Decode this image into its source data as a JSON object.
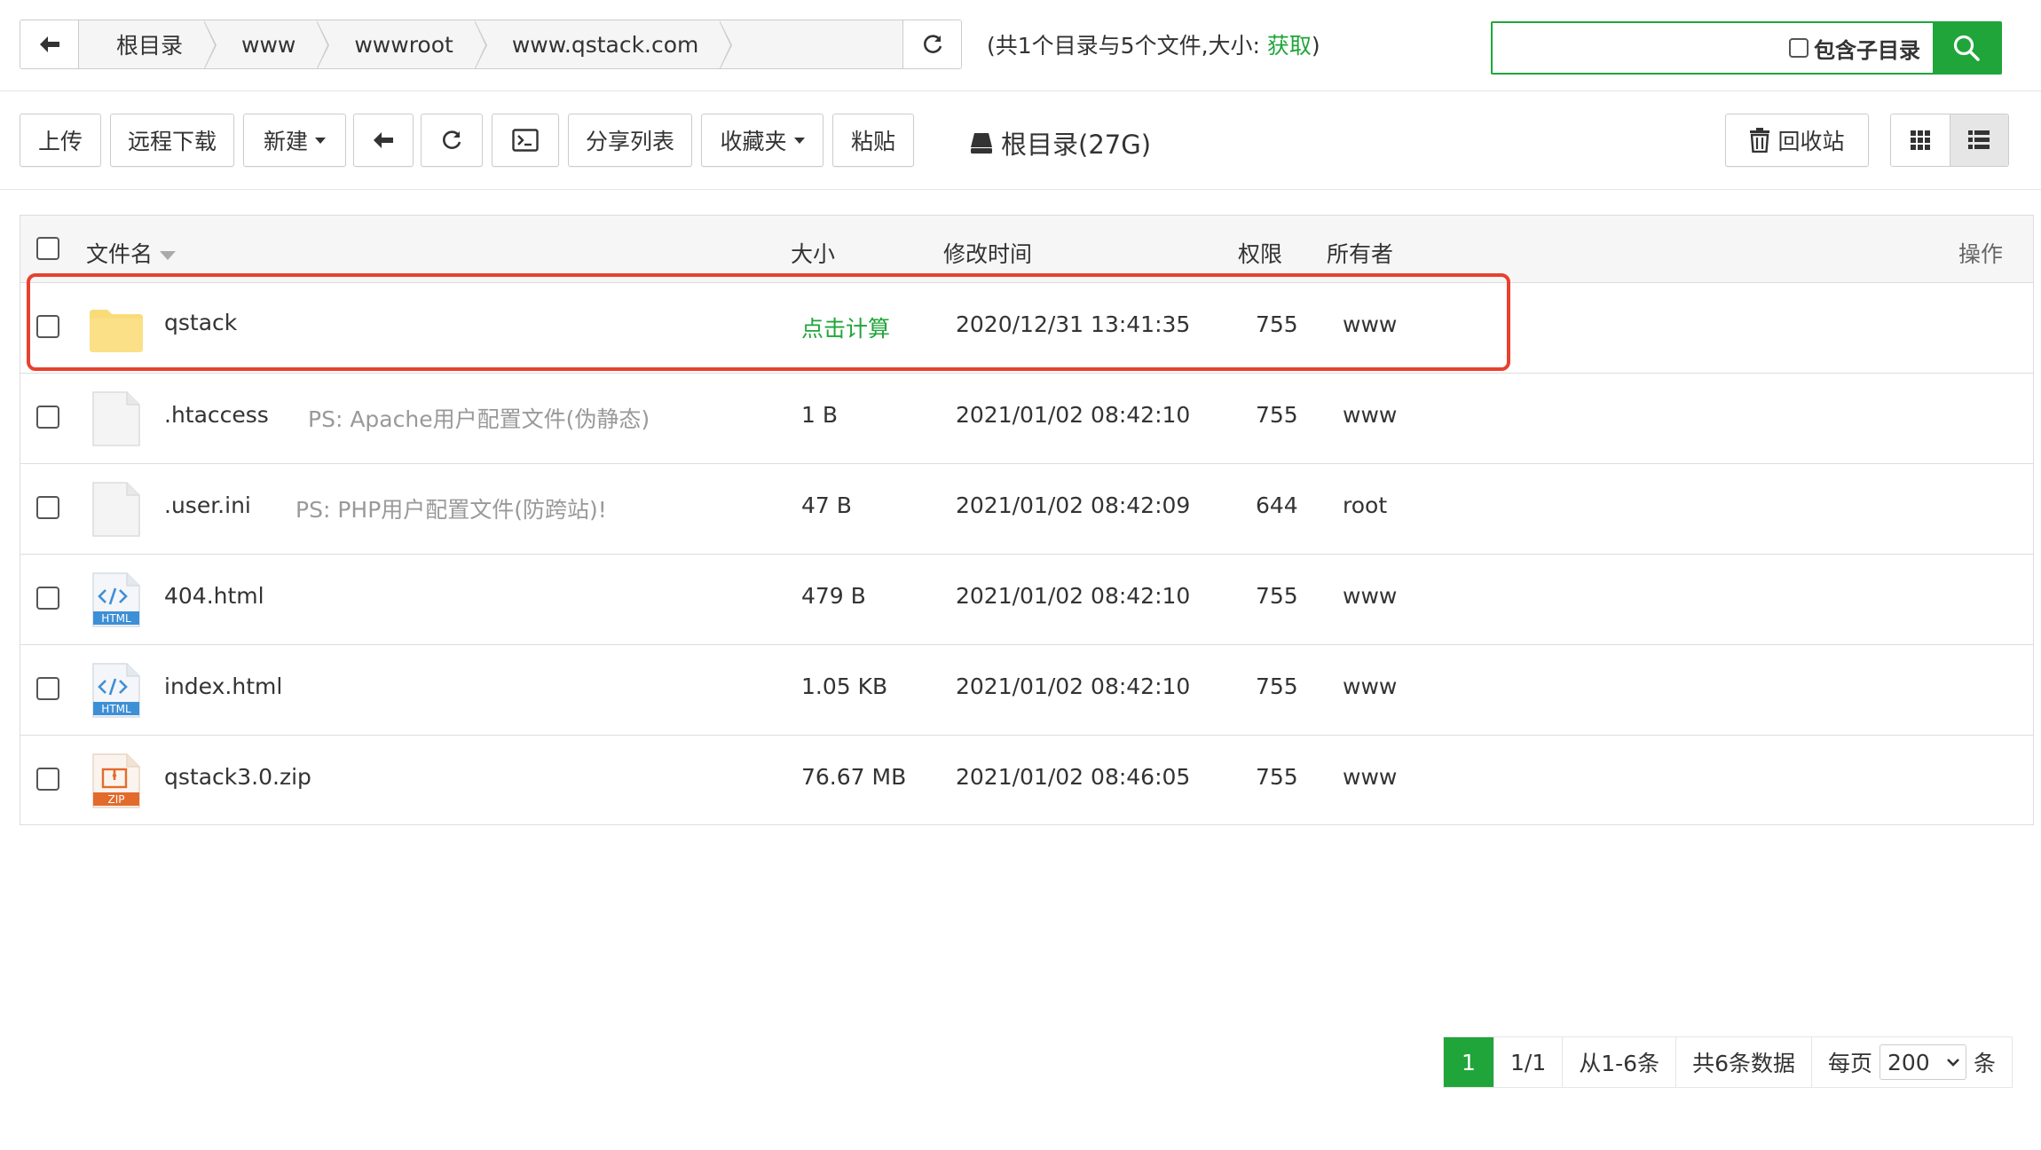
{
  "breadcrumb": {
    "items": [
      "根目录",
      "www",
      "wwwroot",
      "www.qstack.com"
    ]
  },
  "summary": {
    "prefix": "(共1个目录与5个文件,大小: ",
    "link": "获取",
    "suffix": ")"
  },
  "search": {
    "value": "",
    "subdir_label": "包含子目录"
  },
  "toolbar": {
    "upload": "上传",
    "remote_download": "远程下载",
    "new": "新建",
    "share_list": "分享列表",
    "favorites": "收藏夹",
    "paste": "粘贴",
    "disk": "根目录(27G)",
    "recycle": "回收站"
  },
  "table": {
    "headers": {
      "name": "文件名",
      "size": "大小",
      "mtime": "修改时间",
      "perm": "权限",
      "owner": "所有者",
      "ops": "操作"
    },
    "rows": [
      {
        "name": "qstack",
        "ps": "",
        "size": "点击计算",
        "mtime": "2020/12/31 13:41:35",
        "perm": "755",
        "owner": "www",
        "icon": "folder-icon"
      },
      {
        "name": ".htaccess",
        "ps": "PS: Apache用户配置文件(伪静态)",
        "size": "1 B",
        "mtime": "2021/01/02 08:42:10",
        "perm": "755",
        "owner": "www",
        "icon": "file-icon"
      },
      {
        "name": ".user.ini",
        "ps": "PS: PHP用户配置文件(防跨站)!",
        "size": "47 B",
        "mtime": "2021/01/02 08:42:09",
        "perm": "644",
        "owner": "root",
        "icon": "file-icon"
      },
      {
        "name": "404.html",
        "ps": "",
        "size": "479 B",
        "mtime": "2021/01/02 08:42:10",
        "perm": "755",
        "owner": "www",
        "icon": "html-file-icon"
      },
      {
        "name": "index.html",
        "ps": "",
        "size": "1.05 KB",
        "mtime": "2021/01/02 08:42:10",
        "perm": "755",
        "owner": "www",
        "icon": "html-file-icon"
      },
      {
        "name": "qstack3.0.zip",
        "ps": "",
        "size": "76.67 MB",
        "mtime": "2021/01/02 08:46:05",
        "perm": "755",
        "owner": "www",
        "icon": "zip-file-icon"
      }
    ]
  },
  "icon_labels": {
    "html": "HTML",
    "zip": "ZIP"
  },
  "pager": {
    "current": "1",
    "pages": "1/1",
    "range": "从1-6条",
    "total": "共6条数据",
    "per_page_label": "每页",
    "per_page_value": "200",
    "unit": "条"
  },
  "colors": {
    "accent": "#20a53a",
    "highlight": "#e8412f",
    "folder": "#f9dc7a"
  }
}
